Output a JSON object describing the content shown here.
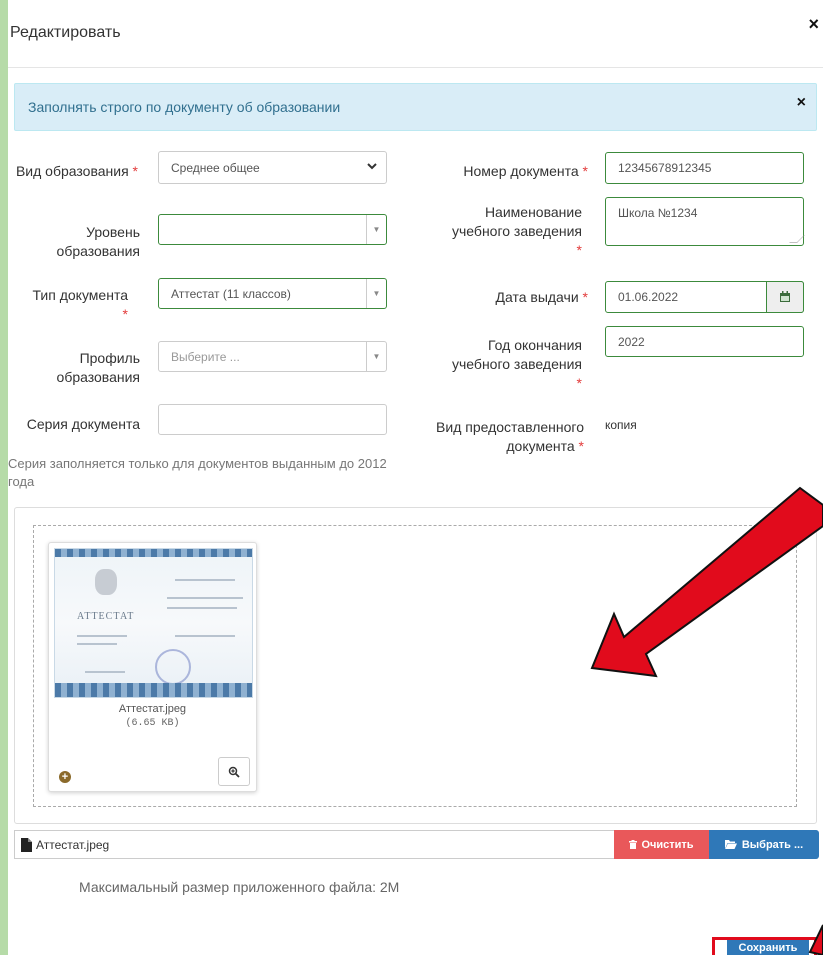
{
  "modal": {
    "title": "Редактировать",
    "close_icon": "close-icon"
  },
  "alert": {
    "text": "Заполнять строго по документу об образовании"
  },
  "form": {
    "education_type": {
      "label": "Вид образования",
      "required_mark": "*",
      "value": "Среднее общее"
    },
    "education_level": {
      "label": "Уровень образования",
      "value": ""
    },
    "document_type": {
      "label": "Тип документа",
      "required_mark": "*",
      "value": "Аттестат (11 классов)"
    },
    "education_profile": {
      "label": "Профиль образования",
      "placeholder": "Выберите ..."
    },
    "document_series": {
      "label": "Серия документа",
      "value": "",
      "hint": "Серия заполняется только для документов выданным до 2012 года"
    },
    "document_number": {
      "label": "Номер документа",
      "required_mark": "*",
      "value": "12345678912345"
    },
    "institution_name": {
      "label": "Наименование учебного заведения",
      "required_mark": "*",
      "value": "Школа №1234"
    },
    "issue_date": {
      "label": "Дата выдачи",
      "required_mark": "*",
      "value": "01.06.2022"
    },
    "graduation_year": {
      "label": "Год окончания учебного заведения",
      "required_mark": "*",
      "value": "2022"
    },
    "provided_document_type": {
      "label": "Вид предоставленного документа",
      "required_mark": "*",
      "value": "копия"
    }
  },
  "upload": {
    "thumbnail": {
      "file_name": "Аттестат.jpeg",
      "file_size": "(6.65 KB)",
      "cert_word": "АТТЕСТАТ"
    },
    "selected_file": "Аттестат.jpeg",
    "clear_label": "Очистить",
    "browse_label": "Выбрать ...",
    "max_size_text": "Максимальный размер приложенного файла: 2M"
  },
  "actions": {
    "save_label": "Сохранить"
  },
  "colors": {
    "background": "#b6dba8",
    "alert_bg": "#d9edf7",
    "alert_text": "#31708f",
    "valid_border": "#3c8a3c",
    "required": "#e23a3a",
    "primary": "#2f78b8",
    "danger": "#e9585a",
    "annotation_red": "#e10b1c"
  }
}
